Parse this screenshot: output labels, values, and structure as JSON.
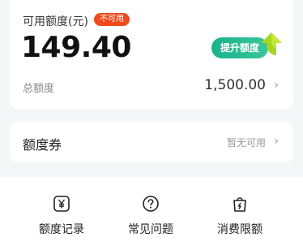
{
  "limit_card": {
    "available_label": "可用额度(元)",
    "status_badge": "不可用",
    "available_amount": "149.40",
    "raise_button": "提升额度",
    "total_label": "总额度",
    "total_value": "1,500.00"
  },
  "coupon_card": {
    "label": "额度券",
    "status": "暂无可用"
  },
  "actions": [
    {
      "label": "额度记录",
      "icon": "yuan-record-icon"
    },
    {
      "label": "常见问题",
      "icon": "question-circle-icon"
    },
    {
      "label": "消费限额",
      "icon": "shopping-bag-icon"
    }
  ],
  "colors": {
    "badge": "#f04a1c",
    "raise_button": "#18b38a",
    "arrow": "#a6d61f"
  }
}
